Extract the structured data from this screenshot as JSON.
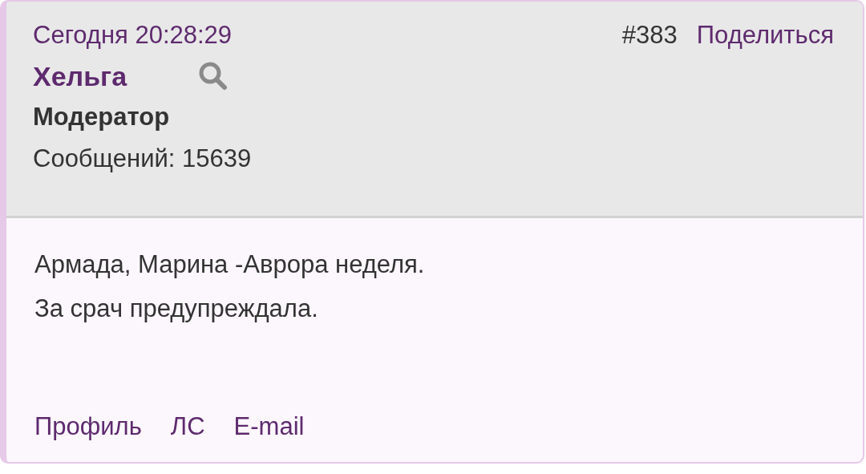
{
  "post": {
    "time": "Сегодня 20:28:29",
    "number": "#383",
    "share": "Поделиться",
    "author": "Хельга",
    "role": "Модератор",
    "posts": "Сообщений: 15639",
    "body": [
      "Армада, Марина -Аврора неделя.",
      "За срач предупреждала."
    ],
    "links": [
      "Профиль",
      "ЛС",
      "E-mail"
    ]
  }
}
